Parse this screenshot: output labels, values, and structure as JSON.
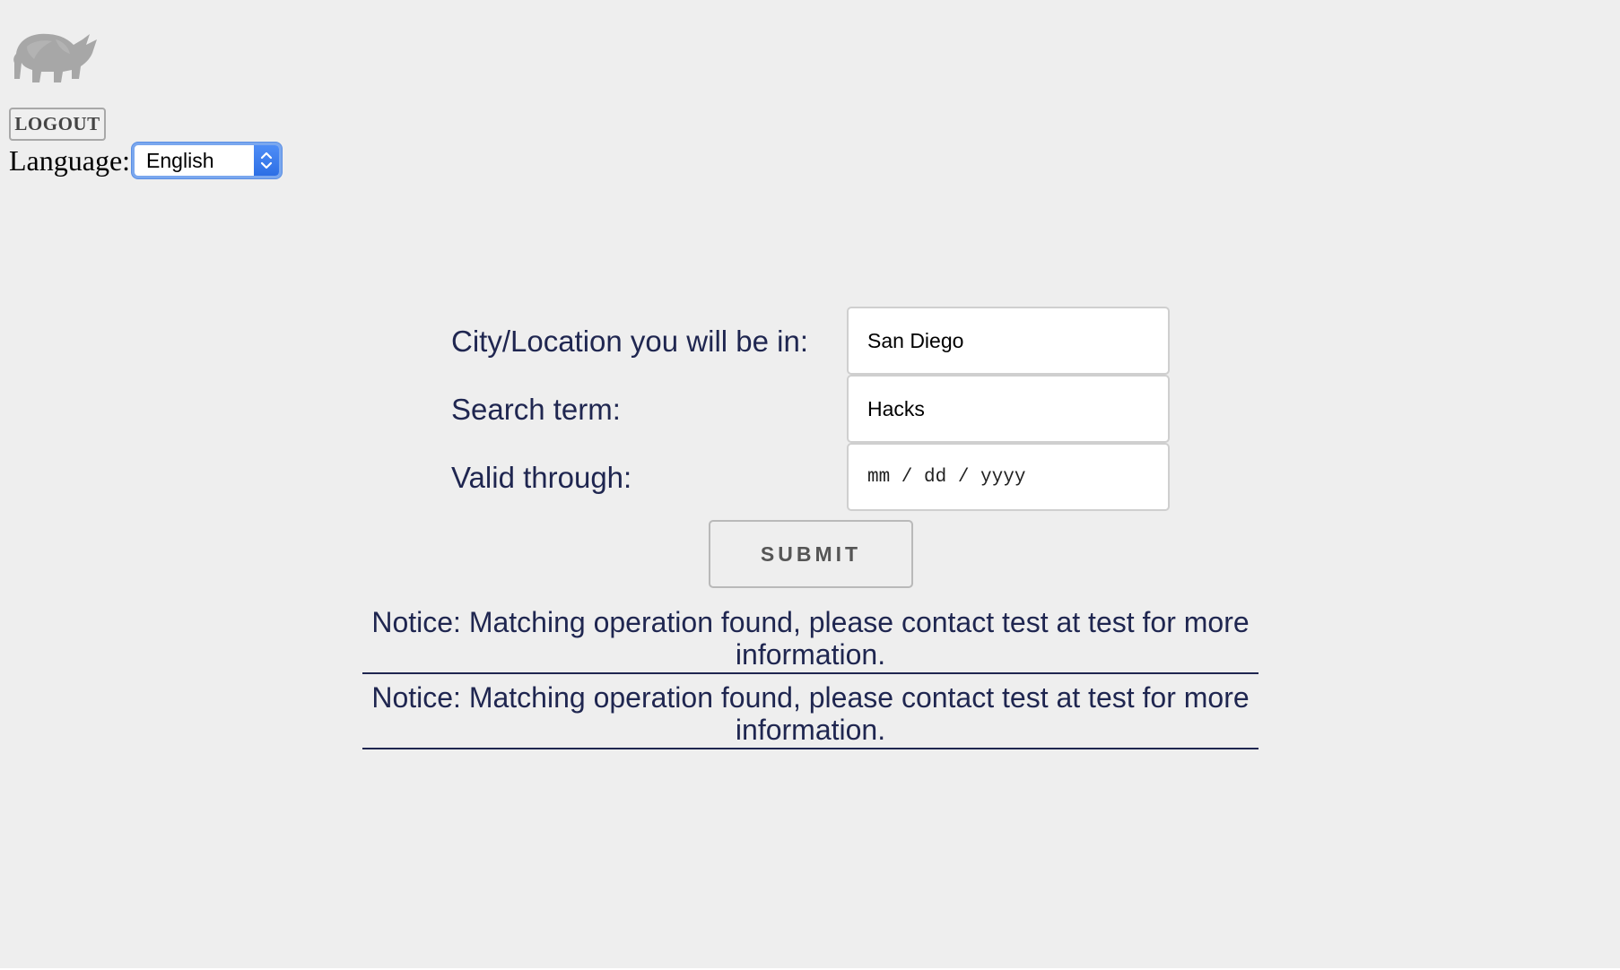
{
  "header": {
    "logo_icon": "rhino-logo-icon",
    "logout_label": "LOGOUT",
    "language_label": "Language:",
    "language_selected": "English"
  },
  "form": {
    "city_label": "City/Location you will be in:",
    "city_value": "San Diego",
    "search_label": "Search term:",
    "search_value": "Hacks",
    "valid_label": "Valid through:",
    "valid_placeholder": "mm / dd / yyyy",
    "submit_label": "SUBMIT"
  },
  "notices": [
    "Notice: Matching operation found, please contact test at test for more information.",
    "Notice: Matching operation found, please contact test at test for more information."
  ],
  "colors": {
    "background": "#eeeeee",
    "text_navy": "#1f2650",
    "select_accent": "#2d6fe5"
  }
}
